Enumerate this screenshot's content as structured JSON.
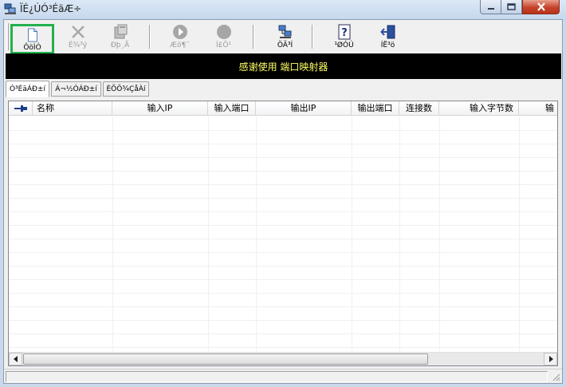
{
  "window": {
    "title": "ÏÉ¿ÚÓ³ÉäÆ÷",
    "controls": {
      "minimize_icon": "minimize-icon",
      "maximize_icon": "maximize-icon",
      "close_icon": "close-icon"
    }
  },
  "toolbar": {
    "buttons": [
      {
        "label": "ÔöÌÓ",
        "icon": "new-document-icon",
        "enabled": true,
        "selected": true
      },
      {
        "label": "É¾³ý",
        "icon": "delete-x-icon",
        "enabled": false
      },
      {
        "label": "Ðþ¸Ã",
        "icon": "edit-icon",
        "enabled": false
      },
      {
        "label": "Æô¶¯",
        "icon": "play-icon",
        "enabled": false
      },
      {
        "label": "Í£Ö¹",
        "icon": "stop-icon",
        "enabled": false
      },
      {
        "label": "ÖÃ³Í",
        "icon": "network-icon",
        "enabled": true
      },
      {
        "label": "¹ØÓÚ",
        "icon": "help-icon",
        "enabled": true
      },
      {
        "label": "ÍË³ö",
        "icon": "exit-door-icon",
        "enabled": true
      }
    ]
  },
  "banner": {
    "text": "感谢使用 端口映射器"
  },
  "tabs": [
    {
      "label": "Ó³ÉäÁÐ±í",
      "active": true
    },
    {
      "label": "Á¬½ÓÁÐ±í",
      "active": false
    },
    {
      "label": "ÈÕÖ¾ÇåÀí",
      "active": false
    }
  ],
  "table": {
    "columns": [
      "",
      "名称",
      "输入IP",
      "输入端口",
      "输出IP",
      "输出端口",
      "连接数",
      "输入字节数",
      "输"
    ],
    "rows": []
  },
  "colors": {
    "banner_bg": "#000000",
    "banner_text": "#ffff66",
    "selected_outline": "#22b14c",
    "titlebar": "#c6d8ee",
    "close_button": "#c6432a"
  }
}
